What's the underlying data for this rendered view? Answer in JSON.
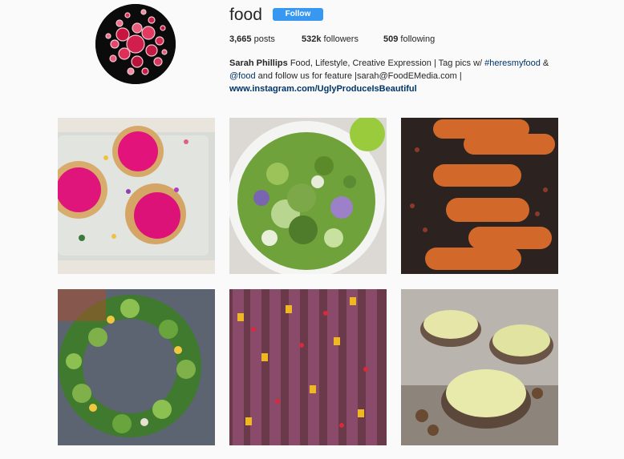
{
  "profile": {
    "username": "food",
    "follow_label": "Follow",
    "stats": {
      "posts_count": "3,665",
      "posts_label": "posts",
      "followers_count": "532k",
      "followers_label": "followers",
      "following_count": "509",
      "following_label": "following"
    },
    "bio": {
      "name": "Sarah Phillips",
      "text1": "Food, Lifestyle, Creative Expression | Tag pics w/",
      "hashtag": "#heresmyfood",
      "text2": "&",
      "mention": "@food",
      "text3": "and follow us for feature |sarah@FoodEMedia.com |",
      "website": "www.instagram.com/UglyProduceIsBeautiful"
    }
  },
  "posts": [
    {
      "subject": "beet tartlets"
    },
    {
      "subject": "green salad bowl"
    },
    {
      "subject": "roasted squash"
    },
    {
      "subject": "avocado rose wreath"
    },
    {
      "subject": "purple carrots"
    },
    {
      "subject": "pear rose tarts"
    }
  ],
  "colors": {
    "follow_button": "#3897f0",
    "link": "#003569",
    "background": "#fafafa"
  }
}
